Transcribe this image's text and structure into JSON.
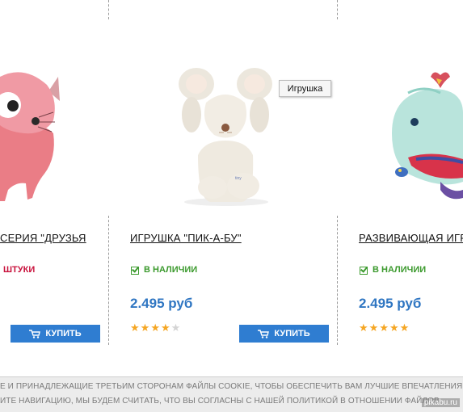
{
  "tooltip": {
    "text": "Игрушка"
  },
  "products": [
    {
      "title": "СЕРИЯ \"ДРУЗЬЯ",
      "stock": "ШТУКИ",
      "buy_label": "КУПИТЬ",
      "image_icon": "pink-cat-toy"
    },
    {
      "title": "ИГРУШКА \"ПИК-А-БУ\"",
      "stock": "В НАЛИЧИИ",
      "price": "2.495 руб",
      "rating": 4,
      "rating_max": 5,
      "buy_label": "КУПИТЬ",
      "image_icon": "mouse-toy"
    },
    {
      "title": "РАЗВИВАЮЩАЯ ИГР",
      "stock": "В НАЛИЧИИ",
      "price": "2.495 руб",
      "rating": 5,
      "rating_max": 5,
      "image_icon": "whale-toy"
    }
  ],
  "cookie_notice": {
    "line1": "Е И ПРИНАДЛЕЖАЩИЕ ТРЕТЬИМ СТОРОНАМ ФАЙЛЫ COOKIE, ЧТОБЫ ОБЕСПЕЧИТЬ ВАМ ЛУЧШИЕ ВПЕЧАТЛЕНИЯ",
    "line2": "ИТЕ НАВИГАЦИЮ, МЫ БУДЕМ СЧИТАТЬ, ЧТО ВЫ СОГЛАСНЫ С НАШЕЙ ПОЛИТИКОЙ В ОТНОШЕНИИ ФАЙЛОВ"
  },
  "watermark": "pikabu.ru",
  "colors": {
    "price": "#2f76c2",
    "button": "#2f7dd1",
    "in_stock": "#3c9a2e",
    "low_stock": "#c8103b",
    "star": "#f5a623"
  }
}
